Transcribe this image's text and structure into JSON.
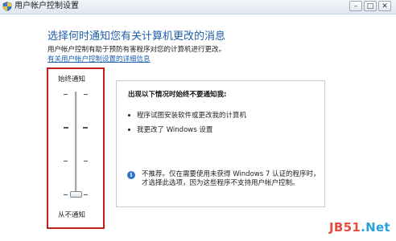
{
  "window": {
    "title": "用户帐户控制设置",
    "buttons": {
      "minimize": "–",
      "maximize": "□",
      "close": "✕"
    }
  },
  "main": {
    "heading": "选择何时通知您有关计算机更改的消息",
    "description": "用户帐户控制有助于预防有害程序对您的计算机进行更改。",
    "link": "有关用户帐户控制设置的详细信息"
  },
  "slider": {
    "top_label": "始终通知",
    "bottom_label": "从不通知",
    "levels": 4,
    "selected_level": 4,
    "selected_level_name": "从不通知"
  },
  "info": {
    "heading": "出现以下情况时始终不要通知我:",
    "bullets": [
      "程序试图安装软件或更改我的计算机",
      "我更改了 Windows 设置"
    ],
    "recommendation": "不推荐。仅在需要使用未获得 Windows 7 认证的程序时，才选择此选项，因为这些程序不支持用户帐户控制。"
  },
  "watermark": {
    "brand": "JB51",
    "dot": ".",
    "tld": "Net"
  },
  "colors": {
    "heading": "#1f5ea8",
    "link": "#1a5fb4",
    "highlight_border": "#c0201c",
    "info_icon": "#2a72c8"
  },
  "icons": {
    "title": "uac-shield-icon",
    "recommendation": "info-icon"
  }
}
